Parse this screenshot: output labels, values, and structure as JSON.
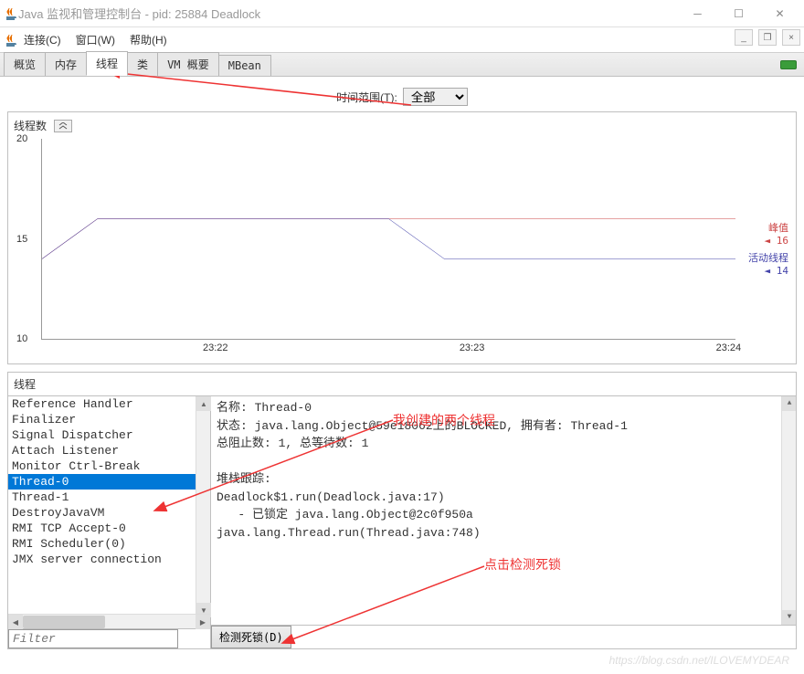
{
  "window": {
    "title": "Java 监视和管理控制台 - pid: 25884 Deadlock"
  },
  "menubar": {
    "items": [
      "连接(C)",
      "窗口(W)",
      "帮助(H)"
    ]
  },
  "tabs": {
    "items": [
      "概览",
      "内存",
      "线程",
      "类",
      "VM 概要",
      "MBean"
    ],
    "active_index": 2
  },
  "time_range": {
    "label": "时间范围(T):",
    "selected": "全部"
  },
  "chart": {
    "section_title": "线程数",
    "legend_peak_label": "峰值",
    "legend_peak_value": "16",
    "legend_live_label": "活动线程",
    "legend_live_value": "14"
  },
  "chart_data": {
    "type": "line",
    "ylim": [
      10,
      20
    ],
    "y_ticks": [
      10,
      15,
      20
    ],
    "x_ticks": [
      "23:22",
      "23:23",
      "23:24"
    ],
    "series": [
      {
        "name": "峰值",
        "color": "#c44",
        "values_y": [
          14,
          16,
          16,
          16,
          16
        ],
        "values_xpct": [
          0,
          8,
          50,
          99,
          100
        ]
      },
      {
        "name": "活动线程",
        "color": "#44a",
        "values_y": [
          14,
          16,
          16,
          14,
          14
        ],
        "values_xpct": [
          0,
          8,
          50,
          58,
          100
        ]
      }
    ]
  },
  "threads_panel": {
    "title": "线程",
    "list": [
      "Reference Handler",
      "Finalizer",
      "Signal Dispatcher",
      "Attach Listener",
      "Monitor Ctrl-Break",
      "Thread-0",
      "Thread-1",
      "DestroyJavaVM",
      "RMI TCP Accept-0",
      "RMI Scheduler(0)",
      "JMX server connection"
    ],
    "selected_index": 5,
    "filter_placeholder": "Filter",
    "detect_button": "检测死锁(D)"
  },
  "thread_detail": {
    "name_label": "名称:",
    "name_value": "Thread-0",
    "state_label": "状态:",
    "state_value": "java.lang.Object@59e18062上的BLOCKED, 拥有者: Thread-1",
    "blocked_label": "总阻止数:",
    "blocked_value": "1, 总等待数: 1",
    "stack_label": "堆栈跟踪:",
    "stack_line1": "Deadlock$1.run(Deadlock.java:17)",
    "stack_line2": "   - 已锁定 java.lang.Object@2c0f950a",
    "stack_line3": "java.lang.Thread.run(Thread.java:748)"
  },
  "annotations": {
    "anno1": "我创建的两个线程",
    "anno2": "点击检测死锁"
  },
  "watermark": "https://blog.csdn.net/ILOVEMYDEAR"
}
